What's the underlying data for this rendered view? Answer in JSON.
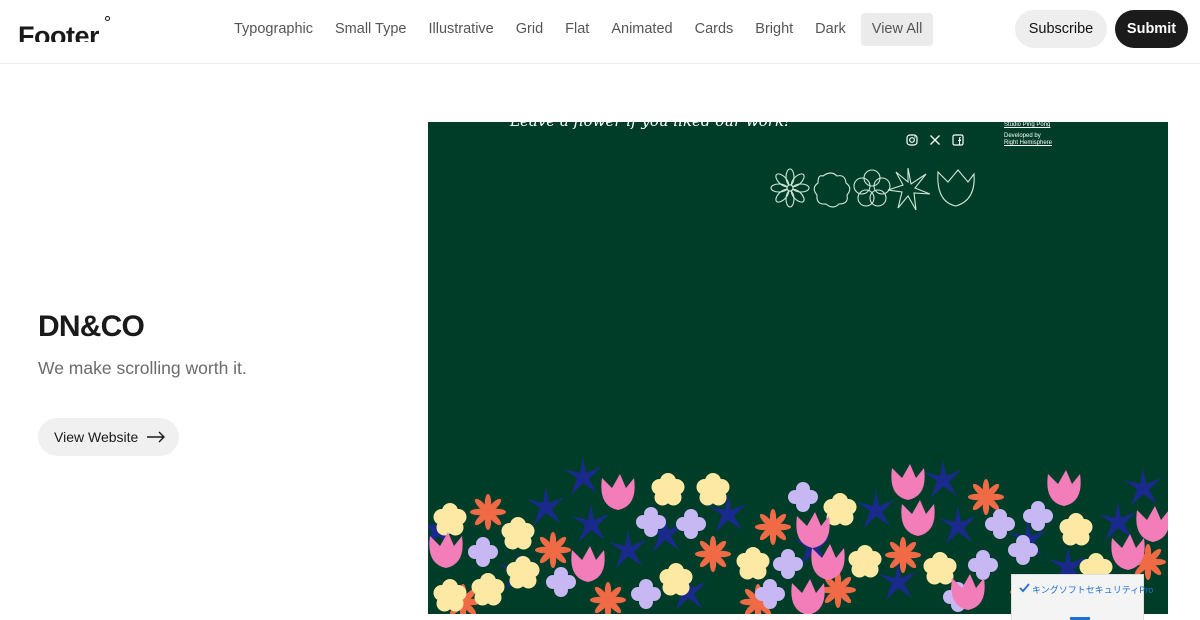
{
  "header": {
    "logo": "Footer",
    "nav": [
      "Typographic",
      "Small Type",
      "Illustrative",
      "Grid",
      "Flat",
      "Animated",
      "Cards",
      "Bright",
      "Dark",
      "View All"
    ],
    "active_nav": "View All",
    "subscribe_label": "Subscribe",
    "submit_label": "Submit"
  },
  "site": {
    "title": "DN&CO",
    "tagline": "We make scrolling worth it.",
    "view_label": "View Website"
  },
  "preview": {
    "message": "Leave a flower if you liked our work!",
    "credit_line1": "Studio Ping Pong",
    "credit_line2": "Developed by",
    "credit_line3": "Right Hemisphere",
    "background_color": "#003d28",
    "icons": [
      "instagram-icon",
      "x-icon",
      "facebook-icon"
    ]
  },
  "badge": {
    "text": "キングソフトセキュリティPro"
  },
  "colors": {
    "accent_dark": "#1b1b1b",
    "badge_blue": "#1f6fd1",
    "flower_pink": "#f27db8",
    "flower_cream": "#fde8a4",
    "flower_lilac": "#c7b8f3",
    "flower_orange": "#f06a45",
    "flower_navy": "#1a2a8c"
  }
}
